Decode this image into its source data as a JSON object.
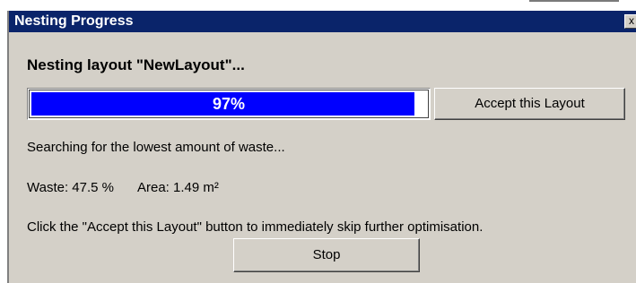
{
  "window": {
    "title": "Nesting Progress",
    "close_label": "x"
  },
  "heading": "Nesting layout \"NewLayout\"...",
  "progress": {
    "value": 0.97,
    "label": "97%",
    "fill_color": "#0000ff"
  },
  "buttons": {
    "accept_label": "Accept this Layout",
    "stop_label": "Stop"
  },
  "status_text": "Searching for the lowest amount of waste...",
  "metrics": {
    "waste": "Waste: 47.5 %",
    "area": "Area: 1.49 m²"
  },
  "hint_text": "Click the \"Accept this Layout\" button to immediately skip further optimisation.",
  "colors": {
    "titlebar": "#0a246a",
    "dialog_background": "#d4d0c8"
  }
}
